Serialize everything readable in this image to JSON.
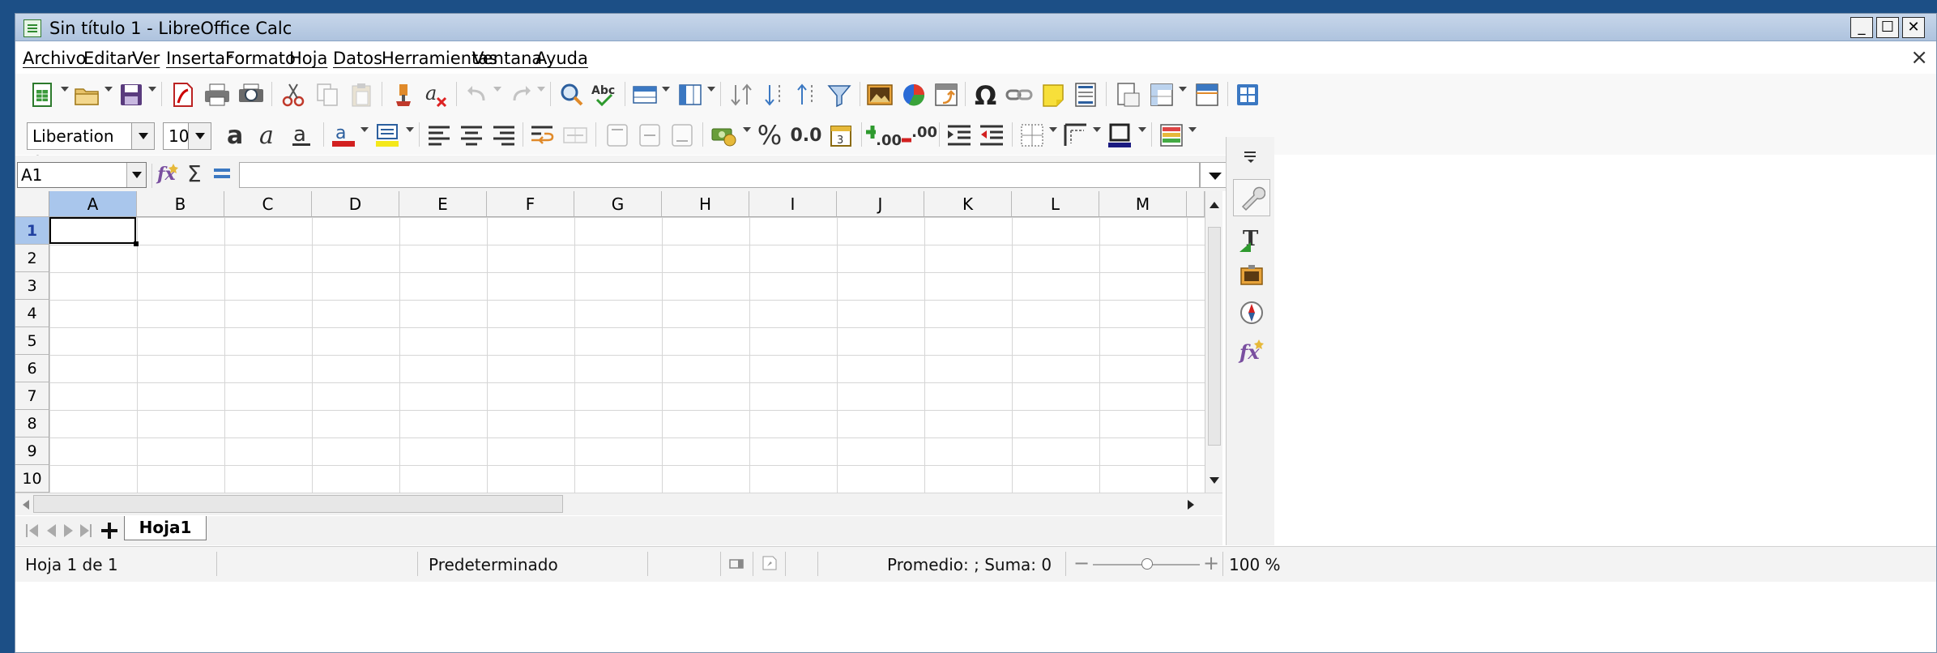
{
  "window": {
    "title": "Sin título 1 - LibreOffice Calc",
    "controls": {
      "minimize": "_",
      "maximize": "☐",
      "close": "✕"
    }
  },
  "menu": {
    "items": [
      "Archivo",
      "Editar",
      "Ver",
      "Insertar",
      "Formato",
      "Hoja",
      "Datos",
      "Herramientas",
      "Ventana",
      "Ayuda"
    ],
    "close_document": "×"
  },
  "formatting": {
    "font_name": "Liberation Sans",
    "font_size": "10",
    "percent_label": "%",
    "decimal_label": "0.0",
    "add_decimal_label": ".00",
    "remove_decimal_label": ".00"
  },
  "formula_bar": {
    "name_box": "A1",
    "formula": ""
  },
  "sheet": {
    "columns": [
      "A",
      "B",
      "C",
      "D",
      "E",
      "F",
      "G",
      "H",
      "I",
      "J",
      "K",
      "L",
      "M"
    ],
    "rows": [
      "1",
      "2",
      "3",
      "4",
      "5",
      "6",
      "7",
      "8",
      "9",
      "10"
    ],
    "selected_column": "A",
    "selected_row": "1"
  },
  "tabs": {
    "sheets": [
      "Hoja1"
    ]
  },
  "status": {
    "sheet_position": "Hoja 1 de 1",
    "page_style": "Predeterminado",
    "summary": "Promedio: ; Suma: 0",
    "zoom": "100 %",
    "zoom_minus": "−",
    "zoom_plus": "+"
  },
  "colors": {
    "selection": "#a9c6ec",
    "titlebar": "#b9cce4"
  }
}
